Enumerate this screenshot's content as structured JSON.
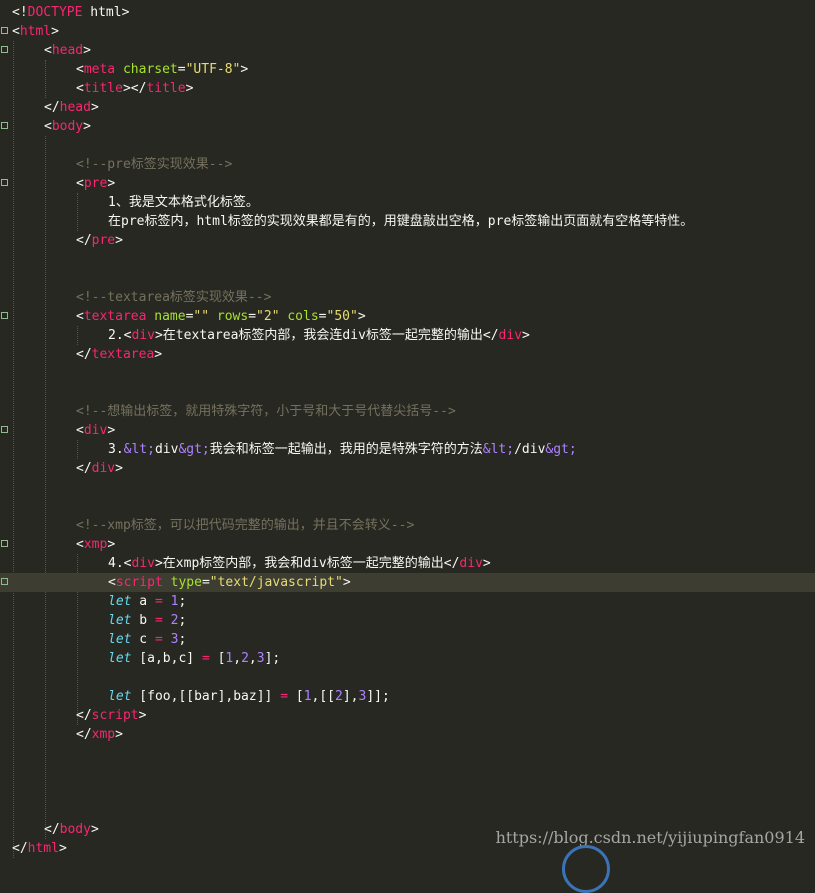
{
  "editor": {
    "lines": [
      {
        "indent": 0,
        "fold": false,
        "tokens": [
          [
            "pun",
            "<!"
          ],
          [
            "tag",
            "DOCTYPE"
          ],
          [
            "pun",
            " html>"
          ]
        ]
      },
      {
        "indent": 0,
        "fold": true,
        "tokens": [
          [
            "pun",
            "<"
          ],
          [
            "tag",
            "html"
          ],
          [
            "pun",
            ">"
          ]
        ]
      },
      {
        "indent": 1,
        "fold": true,
        "tokens": [
          [
            "pun",
            "<"
          ],
          [
            "tag",
            "head"
          ],
          [
            "pun",
            ">"
          ]
        ]
      },
      {
        "indent": 2,
        "fold": false,
        "tokens": [
          [
            "pun",
            "<"
          ],
          [
            "tag",
            "meta"
          ],
          [
            "pun",
            " "
          ],
          [
            "att",
            "charset"
          ],
          [
            "pun",
            "="
          ],
          [
            "str",
            "\"UTF-8\""
          ],
          [
            "pun",
            ">"
          ]
        ]
      },
      {
        "indent": 2,
        "fold": false,
        "tokens": [
          [
            "pun",
            "<"
          ],
          [
            "tag",
            "title"
          ],
          [
            "pun",
            "></"
          ],
          [
            "tag",
            "title"
          ],
          [
            "pun",
            ">"
          ]
        ]
      },
      {
        "indent": 1,
        "fold": false,
        "tokens": [
          [
            "pun",
            "</"
          ],
          [
            "tag",
            "head"
          ],
          [
            "pun",
            ">"
          ]
        ]
      },
      {
        "indent": 1,
        "fold": true,
        "tokens": [
          [
            "pun",
            "<"
          ],
          [
            "tag",
            "body"
          ],
          [
            "pun",
            ">"
          ]
        ]
      },
      {
        "indent": 0,
        "fold": false,
        "tokens": []
      },
      {
        "indent": 2,
        "fold": false,
        "tokens": [
          [
            "com",
            "<!--pre标签实现效果-->"
          ]
        ]
      },
      {
        "indent": 2,
        "fold": true,
        "tokens": [
          [
            "pun",
            "<"
          ],
          [
            "tag",
            "pre"
          ],
          [
            "pun",
            ">"
          ]
        ]
      },
      {
        "indent": 3,
        "fold": false,
        "tokens": [
          [
            "txt",
            "1、我是文本格式化标签。"
          ]
        ]
      },
      {
        "indent": 3,
        "fold": false,
        "tokens": [
          [
            "txt",
            "在pre标签内，html标签的实现效果都是有的，用键盘敲出空格，pre标签输出页面就有空格等特性。"
          ]
        ]
      },
      {
        "indent": 2,
        "fold": false,
        "tokens": [
          [
            "pun",
            "</"
          ],
          [
            "tag",
            "pre"
          ],
          [
            "pun",
            ">"
          ]
        ]
      },
      {
        "indent": 0,
        "fold": false,
        "tokens": []
      },
      {
        "indent": 0,
        "fold": false,
        "tokens": []
      },
      {
        "indent": 2,
        "fold": false,
        "tokens": [
          [
            "com",
            "<!--textarea标签实现效果-->"
          ]
        ]
      },
      {
        "indent": 2,
        "fold": true,
        "tokens": [
          [
            "pun",
            "<"
          ],
          [
            "tag",
            "textarea"
          ],
          [
            "pun",
            " "
          ],
          [
            "att",
            "name"
          ],
          [
            "pun",
            "="
          ],
          [
            "str",
            "\"\""
          ],
          [
            "pun",
            " "
          ],
          [
            "att",
            "rows"
          ],
          [
            "pun",
            "="
          ],
          [
            "str",
            "\"2\""
          ],
          [
            "pun",
            " "
          ],
          [
            "att",
            "cols"
          ],
          [
            "pun",
            "="
          ],
          [
            "str",
            "\"50\""
          ],
          [
            "pun",
            ">"
          ]
        ]
      },
      {
        "indent": 3,
        "fold": false,
        "tokens": [
          [
            "txt",
            "2."
          ],
          [
            "pun",
            "<"
          ],
          [
            "tag",
            "div"
          ],
          [
            "pun",
            ">"
          ],
          [
            "txt",
            "在textarea标签内部，我会连div标签一起完整的输出"
          ],
          [
            "pun",
            "</"
          ],
          [
            "tag",
            "div"
          ],
          [
            "pun",
            ">"
          ]
        ]
      },
      {
        "indent": 2,
        "fold": false,
        "tokens": [
          [
            "pun",
            "</"
          ],
          [
            "tag",
            "textarea"
          ],
          [
            "pun",
            ">"
          ]
        ]
      },
      {
        "indent": 0,
        "fold": false,
        "tokens": []
      },
      {
        "indent": 0,
        "fold": false,
        "tokens": []
      },
      {
        "indent": 2,
        "fold": false,
        "tokens": [
          [
            "com",
            "<!--想输出标签，就用特殊字符，小于号和大于号代替尖括号-->"
          ]
        ]
      },
      {
        "indent": 2,
        "fold": true,
        "tokens": [
          [
            "pun",
            "<"
          ],
          [
            "tag",
            "div"
          ],
          [
            "pun",
            ">"
          ]
        ]
      },
      {
        "indent": 3,
        "fold": false,
        "tokens": [
          [
            "txt",
            "3."
          ],
          [
            "ent",
            "&lt;"
          ],
          [
            "txt",
            "div"
          ],
          [
            "ent",
            "&gt;"
          ],
          [
            "txt",
            "我会和标签一起输出，我用的是特殊字符的方法"
          ],
          [
            "ent",
            "&lt;"
          ],
          [
            "txt",
            "/div"
          ],
          [
            "ent",
            "&gt;"
          ]
        ]
      },
      {
        "indent": 2,
        "fold": false,
        "tokens": [
          [
            "pun",
            "</"
          ],
          [
            "tag",
            "div"
          ],
          [
            "pun",
            ">"
          ]
        ]
      },
      {
        "indent": 0,
        "fold": false,
        "tokens": []
      },
      {
        "indent": 0,
        "fold": false,
        "tokens": []
      },
      {
        "indent": 2,
        "fold": false,
        "tokens": [
          [
            "com",
            "<!--xmp标签，可以把代码完整的输出，并且不会转义-->"
          ]
        ]
      },
      {
        "indent": 2,
        "fold": true,
        "tokens": [
          [
            "pun",
            "<"
          ],
          [
            "tag",
            "xmp"
          ],
          [
            "pun",
            ">"
          ]
        ]
      },
      {
        "indent": 3,
        "fold": false,
        "tokens": [
          [
            "txt",
            "4."
          ],
          [
            "pun",
            "<"
          ],
          [
            "tag",
            "div"
          ],
          [
            "pun",
            ">"
          ],
          [
            "txt",
            "在xmp标签内部，我会和div标签一起完整的输出"
          ],
          [
            "pun",
            "</"
          ],
          [
            "tag",
            "div"
          ],
          [
            "pun",
            ">"
          ]
        ]
      },
      {
        "indent": 3,
        "fold": true,
        "current": true,
        "tokens": [
          [
            "pun",
            "<"
          ],
          [
            "tag",
            "script"
          ],
          [
            "pun",
            " "
          ],
          [
            "att",
            "type"
          ],
          [
            "pun",
            "="
          ],
          [
            "str",
            "\"text/javascript\""
          ],
          [
            "pun",
            ">"
          ]
        ]
      },
      {
        "indent": 3,
        "fold": false,
        "tokens": [
          [
            "kw",
            "let"
          ],
          [
            "txt",
            " a "
          ],
          [
            "op",
            "="
          ],
          [
            "txt",
            " "
          ],
          [
            "num",
            "1"
          ],
          [
            "txt",
            ";"
          ]
        ]
      },
      {
        "indent": 3,
        "fold": false,
        "tokens": [
          [
            "kw",
            "let"
          ],
          [
            "txt",
            " b "
          ],
          [
            "op",
            "="
          ],
          [
            "txt",
            " "
          ],
          [
            "num",
            "2"
          ],
          [
            "txt",
            ";"
          ]
        ]
      },
      {
        "indent": 3,
        "fold": false,
        "tokens": [
          [
            "kw",
            "let"
          ],
          [
            "txt",
            " c "
          ],
          [
            "op",
            "="
          ],
          [
            "txt",
            " "
          ],
          [
            "num",
            "3"
          ],
          [
            "txt",
            ";"
          ]
        ]
      },
      {
        "indent": 3,
        "fold": false,
        "tokens": [
          [
            "kw",
            "let"
          ],
          [
            "txt",
            " [a,b,c] "
          ],
          [
            "op",
            "="
          ],
          [
            "txt",
            " ["
          ],
          [
            "num",
            "1"
          ],
          [
            "txt",
            ","
          ],
          [
            "num",
            "2"
          ],
          [
            "txt",
            ","
          ],
          [
            "num",
            "3"
          ],
          [
            "txt",
            "];"
          ]
        ]
      },
      {
        "indent": 0,
        "fold": false,
        "tokens": []
      },
      {
        "indent": 3,
        "fold": false,
        "tokens": [
          [
            "kw",
            "let"
          ],
          [
            "txt",
            " [foo,[[bar],baz]] "
          ],
          [
            "op",
            "="
          ],
          [
            "txt",
            " ["
          ],
          [
            "num",
            "1"
          ],
          [
            "txt",
            ",[["
          ],
          [
            "num",
            "2"
          ],
          [
            "txt",
            "],"
          ],
          [
            "num",
            "3"
          ],
          [
            "txt",
            "]];"
          ]
        ]
      },
      {
        "indent": 2,
        "fold": false,
        "tokens": [
          [
            "pun",
            "</"
          ],
          [
            "tag",
            "script"
          ],
          [
            "pun",
            ">"
          ]
        ]
      },
      {
        "indent": 2,
        "fold": false,
        "tokens": [
          [
            "pun",
            "</"
          ],
          [
            "tag",
            "xmp"
          ],
          [
            "pun",
            ">"
          ]
        ]
      },
      {
        "indent": 0,
        "fold": false,
        "tokens": []
      },
      {
        "indent": 0,
        "fold": false,
        "tokens": []
      },
      {
        "indent": 0,
        "fold": false,
        "tokens": []
      },
      {
        "indent": 0,
        "fold": false,
        "tokens": []
      },
      {
        "indent": 1,
        "fold": false,
        "tokens": [
          [
            "pun",
            "</"
          ],
          [
            "tag",
            "body"
          ],
          [
            "pun",
            ">"
          ]
        ]
      },
      {
        "indent": 0,
        "fold": false,
        "tokens": [
          [
            "pun",
            "</"
          ],
          [
            "tag",
            "html"
          ],
          [
            "pun",
            ">"
          ]
        ]
      }
    ]
  },
  "watermark": {
    "text": "https://blog.csdn.net/yijiupingfan0914"
  },
  "colors": {
    "background": "#272822",
    "tag": "#f92672",
    "attribute": "#a6e22e",
    "string": "#e6db74",
    "comment": "#75715e",
    "keyword": "#66d9ef",
    "number": "#ae81ff"
  }
}
